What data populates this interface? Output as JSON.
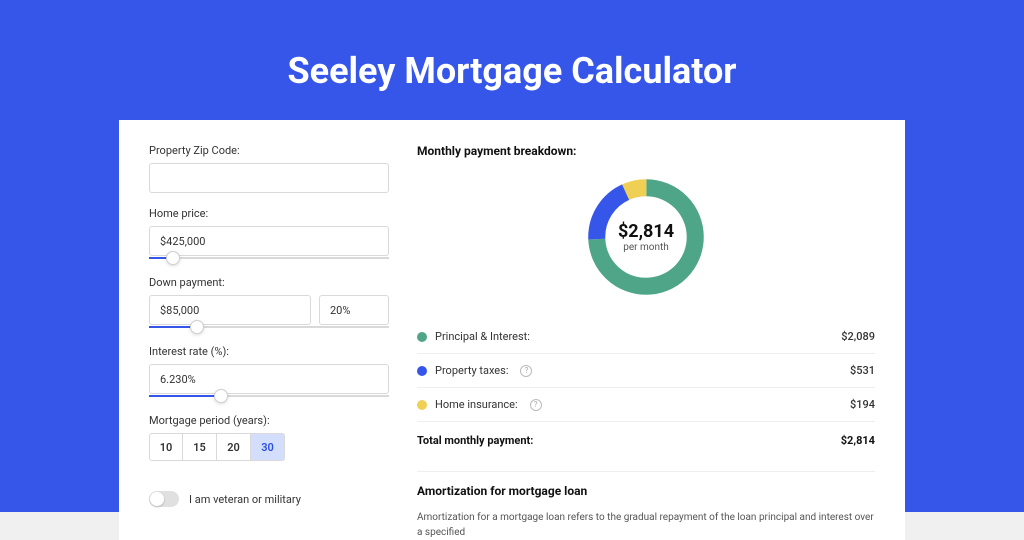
{
  "page": {
    "title": "Seeley Mortgage Calculator"
  },
  "form": {
    "zip": {
      "label": "Property Zip Code:",
      "value": ""
    },
    "home_price": {
      "label": "Home price:",
      "value": "$425,000",
      "slider_pct": 10
    },
    "down_payment": {
      "label": "Down payment:",
      "amount": "$85,000",
      "percent": "20%",
      "slider_pct": 20
    },
    "interest_rate": {
      "label": "Interest rate (%):",
      "value": "6.230%",
      "slider_pct": 30
    },
    "mortgage_period": {
      "label": "Mortgage period (years):",
      "options": [
        "10",
        "15",
        "20",
        "30"
      ],
      "selected": "30"
    },
    "veteran": {
      "label": "I am veteran or military",
      "checked": false
    }
  },
  "breakdown": {
    "title": "Monthly payment breakdown:",
    "center_amount": "$2,814",
    "center_sub": "per month",
    "items": [
      {
        "label": "Principal & Interest:",
        "value": "$2,089",
        "color": "#4fa588",
        "info": false
      },
      {
        "label": "Property taxes:",
        "value": "$531",
        "color": "#3556e8",
        "info": true
      },
      {
        "label": "Home insurance:",
        "value": "$194",
        "color": "#efcf54",
        "info": true
      }
    ],
    "total": {
      "label": "Total monthly payment:",
      "value": "$2,814"
    }
  },
  "amortization": {
    "title": "Amortization for mortgage loan",
    "body": "Amortization for a mortgage loan refers to the gradual repayment of the loan principal and interest over a specified"
  },
  "chart_data": {
    "type": "pie",
    "title": "Monthly payment breakdown",
    "series": [
      {
        "name": "Principal & Interest",
        "value": 2089,
        "color": "#4fa588"
      },
      {
        "name": "Property taxes",
        "value": 531,
        "color": "#3556e8"
      },
      {
        "name": "Home insurance",
        "value": 194,
        "color": "#efcf54"
      }
    ],
    "total": 2814
  }
}
